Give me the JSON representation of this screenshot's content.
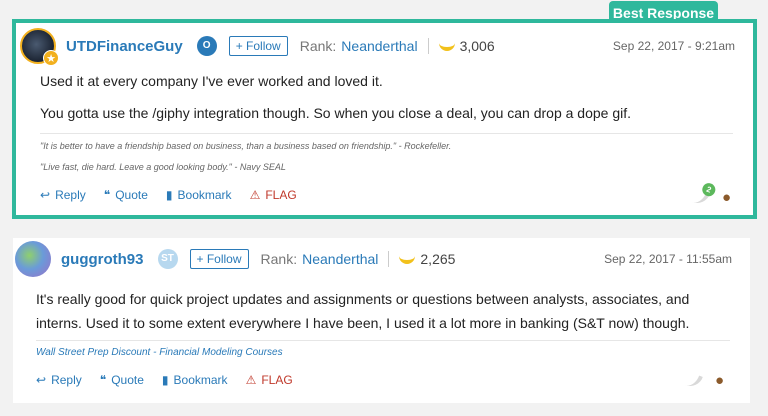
{
  "posts": [
    {
      "badge": "Best Response",
      "username": "UTDFinanceGuy",
      "initial": "O",
      "follow_label": "+ Follow",
      "rank_label": "Rank:",
      "rank": "Neanderthal",
      "bananas": "3,006",
      "date": "Sep 22, 2017 - 9:21am",
      "paragraphs": [
        "Used it at every company I've ever worked and loved it.",
        "You gotta use the /giphy integration though. So when you close a deal, you can drop a dope gif."
      ],
      "quotes": [
        "\"It is better to have a friendship based on business, than a business based on friendship.\" - Rockefeller.",
        "\"Live fast, die hard. Leave a good looking body.\" - Navy SEAL"
      ],
      "actions": {
        "reply": "Reply",
        "quote": "Quote",
        "bookmark": "Bookmark",
        "flag": "FLAG"
      },
      "reaction_count": "2"
    },
    {
      "username": "guggroth93",
      "initial": "ST",
      "follow_label": "+ Follow",
      "rank_label": "Rank:",
      "rank": "Neanderthal",
      "bananas": "2,265",
      "date": "Sep 22, 2017 - 11:55am",
      "paragraphs": [
        "It's really good for quick project updates and assignments or questions between analysts, associates, and interns. Used it to some extent everywhere I have been, I used it a lot more in banking (S&T now) though."
      ],
      "signature_link": "Wall Street Prep Discount - Financial Modeling Courses",
      "actions": {
        "reply": "Reply",
        "quote": "Quote",
        "bookmark": "Bookmark",
        "flag": "FLAG"
      }
    }
  ],
  "colors": {
    "accent": "#2fb89c",
    "link": "#2a7ab8",
    "flag": "#c0392b"
  },
  "icons": [
    "reply-icon",
    "quote-icon",
    "bookmark-icon",
    "warning-icon",
    "banana-icon",
    "poop-icon"
  ]
}
